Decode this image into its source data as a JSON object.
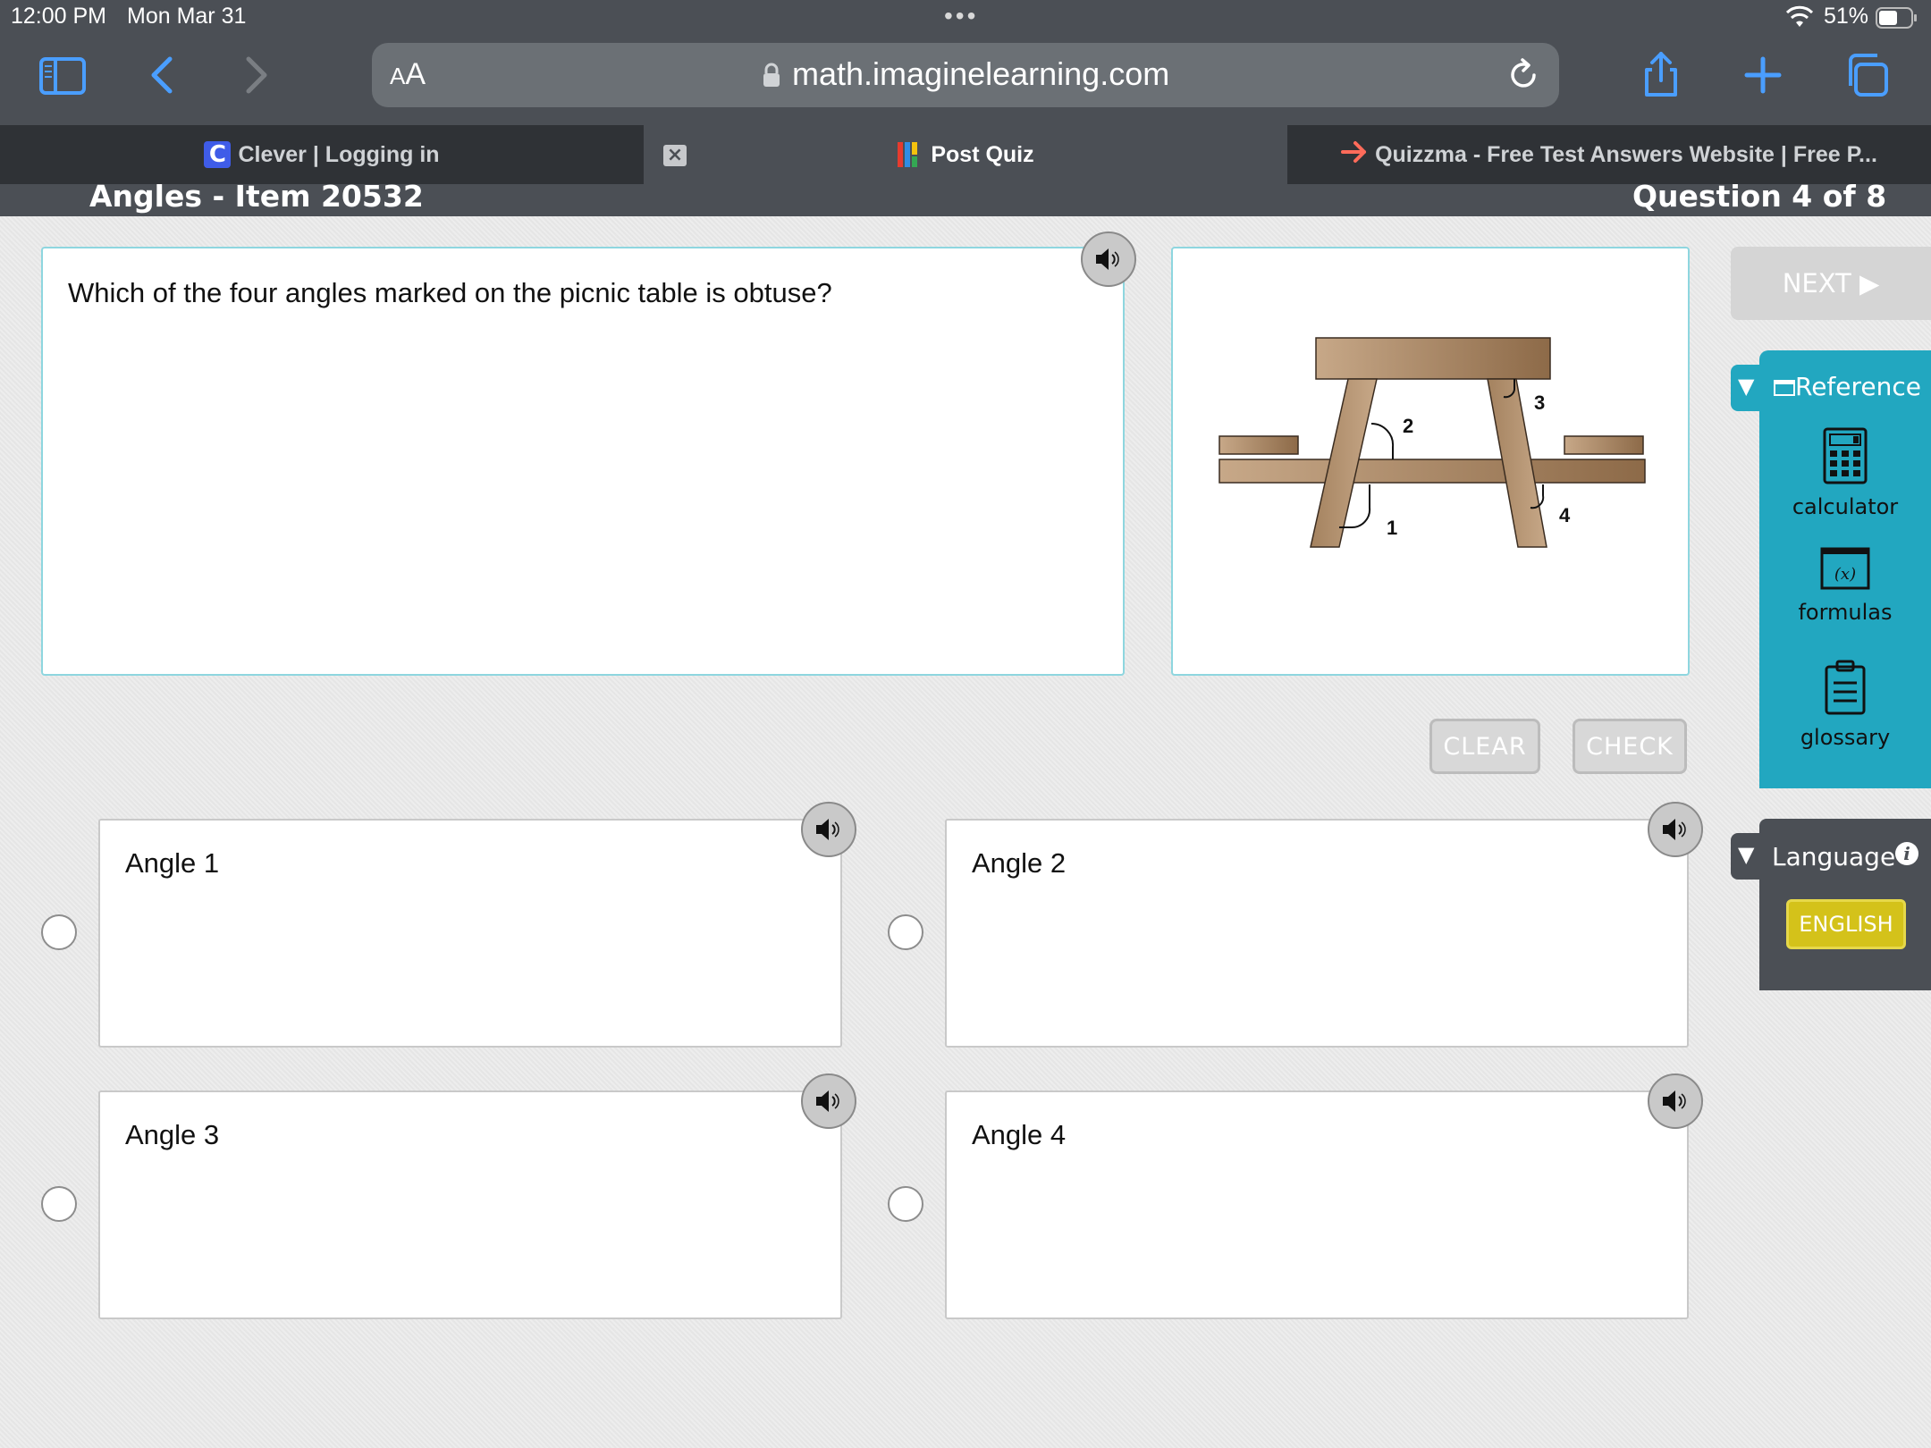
{
  "status_bar": {
    "time": "12:00 PM",
    "date": "Mon Mar 31",
    "battery": "51%",
    "dots": "•••"
  },
  "browser": {
    "aa_big": "A",
    "aa_small": "A",
    "url": "math.imaginelearning.com",
    "tabs": [
      {
        "label": "Clever | Logging in",
        "favicon": "C"
      },
      {
        "label": "Post Quiz"
      },
      {
        "label": "Quizzma - Free Test Answers Website | Free P..."
      }
    ],
    "tab_close": "×"
  },
  "header": {
    "item_title": "Angles - Item 20532",
    "question_count": "Question 4 of 8"
  },
  "question": {
    "text": "Which of the four angles marked on the picnic table is obtuse?"
  },
  "figure": {
    "angle_labels": [
      "1",
      "2",
      "3",
      "4"
    ],
    "colors": {
      "wood_light": "#c7a888",
      "wood_dark": "#8d6a48",
      "outline": "#3a2c20"
    }
  },
  "buttons": {
    "clear": "CLEAR",
    "check": "CHECK",
    "next": "NEXT ▶"
  },
  "choices": [
    {
      "label": "Angle 1"
    },
    {
      "label": "Angle 2"
    },
    {
      "label": "Angle 3"
    },
    {
      "label": "Angle 4"
    }
  ],
  "reference": {
    "arrow": "▼",
    "title": "Reference",
    "items": [
      {
        "label": "calculator",
        "icon": "calculator-icon"
      },
      {
        "label": "formulas",
        "icon": "formulas-icon"
      },
      {
        "label": "glossary",
        "icon": "glossary-icon"
      }
    ]
  },
  "language": {
    "arrow": "▼",
    "title": "Language",
    "info": "i",
    "selected": "ENGLISH"
  },
  "colors": {
    "chrome": "#4b4f55",
    "accent_teal": "#22a7c0",
    "english_yellow": "#d4c21a",
    "panel_border": "#8ed6df"
  }
}
